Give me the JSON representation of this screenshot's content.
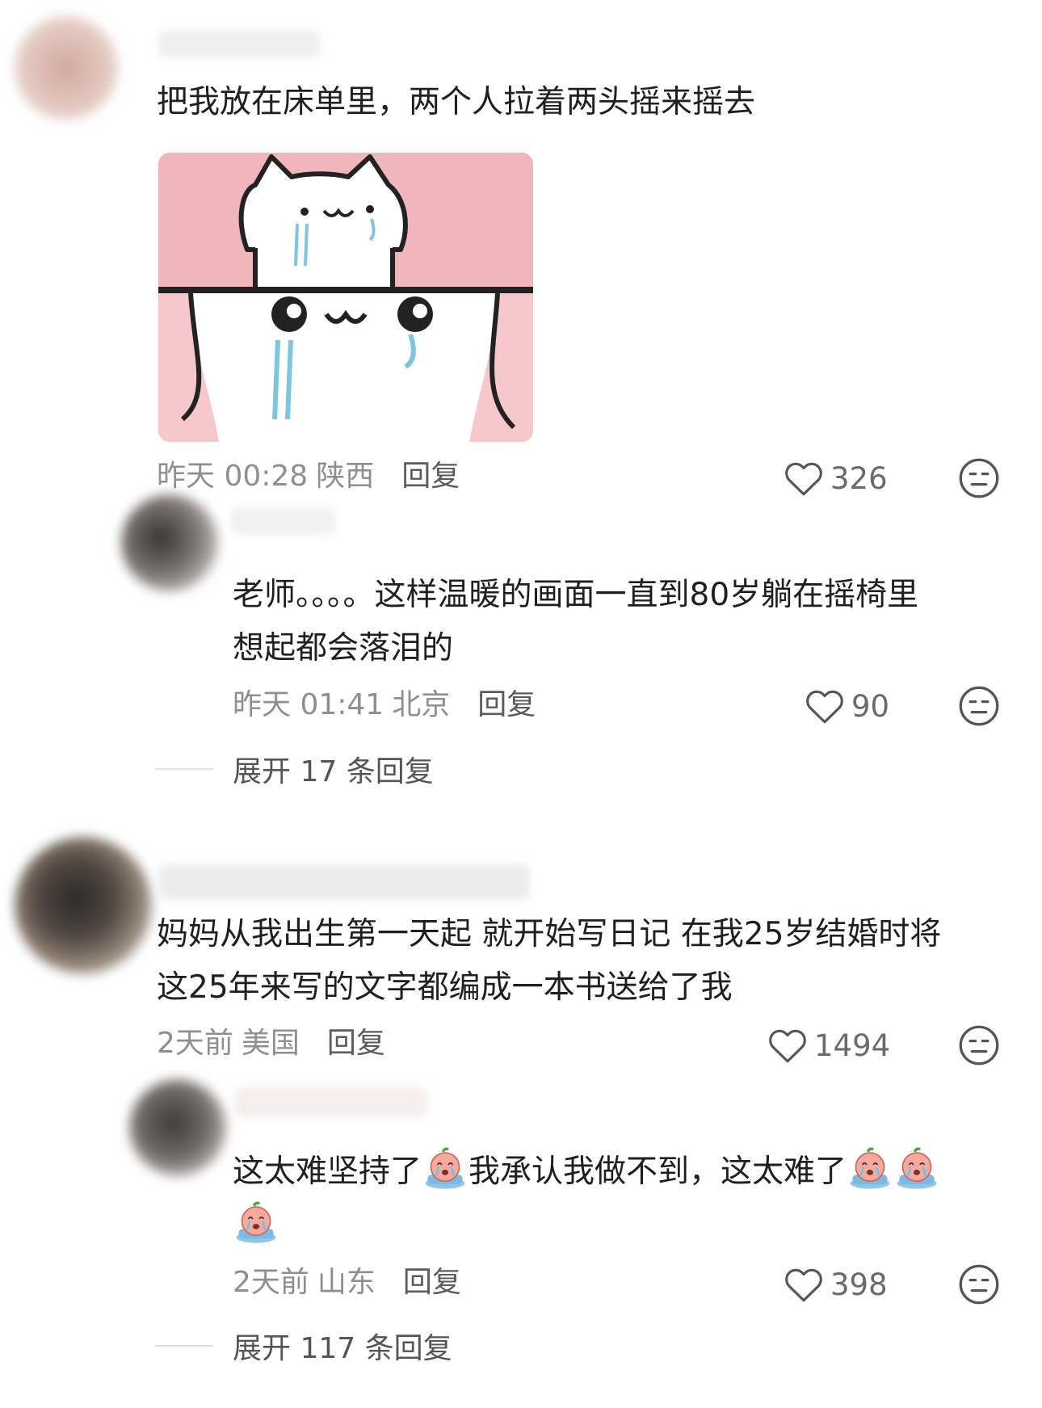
{
  "comments": [
    {
      "text": "把我放在床单里，两个人拉着两头摇来摇去",
      "meta": {
        "time": "昨天 00:28",
        "location": "陕西",
        "reply": "回复"
      },
      "likes": "326",
      "has_sticker": true
    },
    {
      "text_lines": [
        "老师。。。。这样温暖的画面一直到80岁躺在摇椅里",
        "想起都会落泪的"
      ],
      "meta": {
        "time": "昨天 01:41",
        "location": "北京",
        "reply": "回复"
      },
      "likes": "90",
      "expand": "展开 17 条回复"
    },
    {
      "text_lines": [
        "妈妈从我出生第一天起 就开始写日记 在我25岁结婚时将",
        "这25年来写的文字都编成一本书送给了我"
      ],
      "meta": {
        "time": "2天前",
        "location": "美国",
        "reply": "回复"
      },
      "likes": "1494"
    },
    {
      "segments": [
        "这太难坚持了",
        "我承认我做不到，这太难了"
      ],
      "meta": {
        "time": "2天前",
        "location": "山东",
        "reply": "回复"
      },
      "likes": "398",
      "expand": "展开 117 条回复"
    }
  ],
  "icons": {
    "like": "heart-outline-icon",
    "dislike": "meh-face-icon",
    "emoji": "crying-face-emoji"
  },
  "colors": {
    "text": "#1f1f1f",
    "meta": "#8f8f8f",
    "sticker_bg": "#f0b6bc"
  }
}
